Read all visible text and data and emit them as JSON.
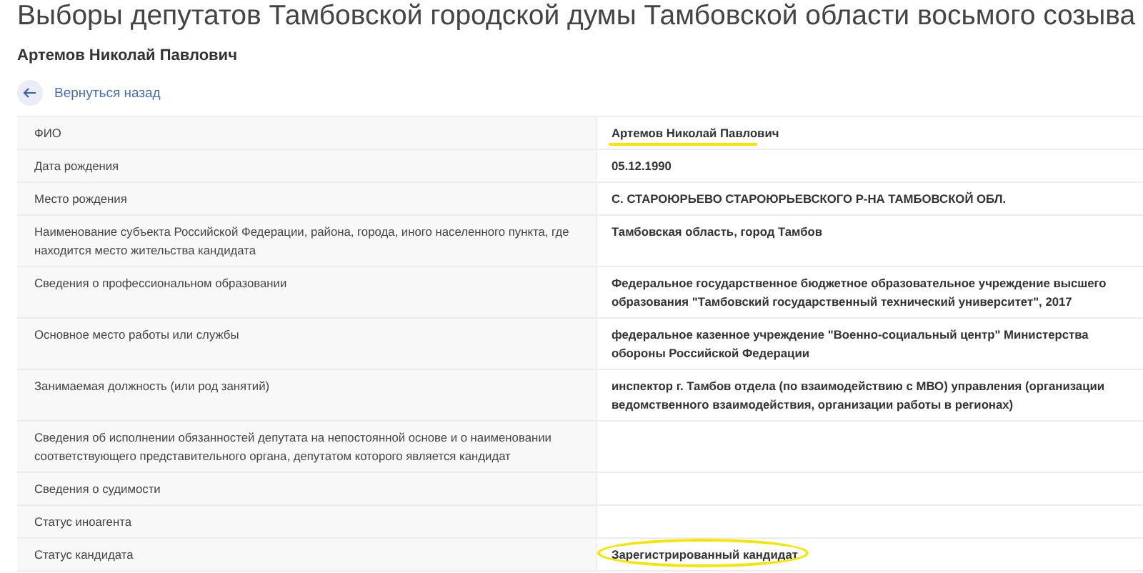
{
  "page_title": "Выборы депутатов Тамбовской городской думы Тамбовской области восьмого созыва",
  "candidate_name": "Артемов Николай Павлович",
  "back_link": "Вернуться назад",
  "rows": [
    {
      "label": "ФИО",
      "value": "Артемов Николай Павлович",
      "underlined": true,
      "circled": false
    },
    {
      "label": "Дата рождения",
      "value": "05.12.1990",
      "underlined": false,
      "circled": false
    },
    {
      "label": "Место рождения",
      "value": "С. СТАРОЮРЬЕВО СТАРОЮРЬЕВСКОГО Р-НА ТАМБОВСКОЙ ОБЛ.",
      "underlined": false,
      "circled": false
    },
    {
      "label": "Наименование субъекта Российской Федерации, района, города, иного населенного пункта, где находится место жительства кандидата",
      "value": "Тамбовская область, город Тамбов",
      "underlined": false,
      "circled": false
    },
    {
      "label": "Сведения о профессиональном образовании",
      "value": "Федеральное государственное бюджетное образовательное учреждение высшего образования \"Тамбовский государственный технический университет\", 2017",
      "underlined": false,
      "circled": false
    },
    {
      "label": "Основное место работы или службы",
      "value": "федеральное казенное учреждение \"Военно-социальный центр\" Министерства обороны Российской Федерации",
      "underlined": false,
      "circled": false
    },
    {
      "label": "Занимаемая должность (или род занятий)",
      "value": "инспектор г. Тамбов отдела (по взаимодействию с МВО) управления (организации ведомственного взаимодействия, организации работы в регионах)",
      "underlined": false,
      "circled": false
    },
    {
      "label": "Сведения об исполнении обязанностей депутата на непостоянной основе и о наименовании соответствующего представительного органа, депутатом которого является кандидат"
    },
    {
      "label": "Сведения о судимости"
    },
    {
      "label": "Статус иноагента"
    },
    {
      "label": "Статус кандидата",
      "value": "Зарегистрированный кандидат",
      "underlined": false,
      "circled": true
    }
  ]
}
